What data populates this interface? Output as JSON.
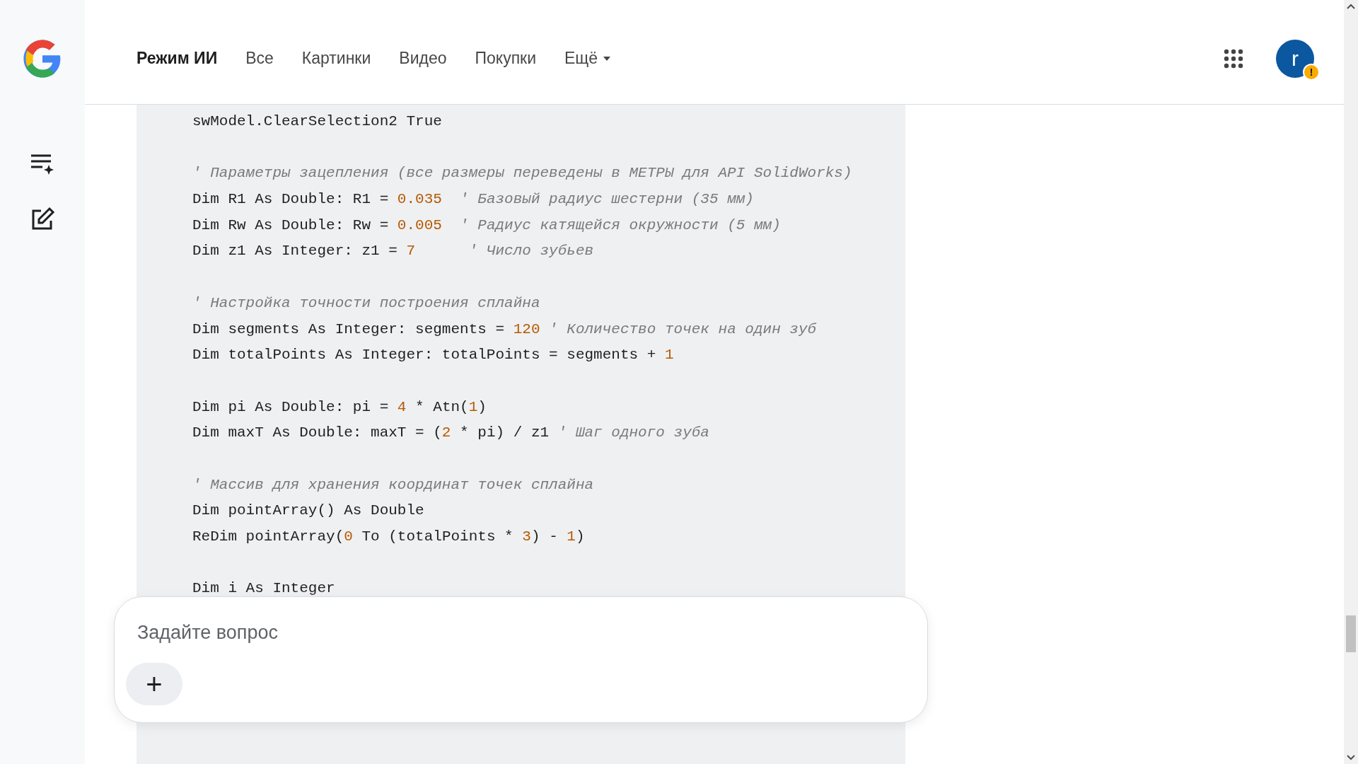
{
  "header": {
    "tabs": [
      {
        "label": "Режим ИИ",
        "selected": true
      },
      {
        "label": "Все",
        "selected": false
      },
      {
        "label": "Картинки",
        "selected": false
      },
      {
        "label": "Видео",
        "selected": false
      },
      {
        "label": "Покупки",
        "selected": false
      },
      {
        "label": "Ещё",
        "selected": false,
        "kind": "dropdown"
      }
    ],
    "avatar": {
      "letter": "r",
      "badge": "!"
    }
  },
  "code": {
    "lines": [
      {
        "kind": "code",
        "tokens": [
          {
            "kind": "text",
            "t": "swModel.ClearSelection2 True"
          }
        ]
      },
      {
        "kind": "blank"
      },
      {
        "kind": "code",
        "tokens": [
          {
            "kind": "comment",
            "t": "' Параметры зацепления (все размеры переведены в МЕТРЫ для API SolidWorks)"
          }
        ]
      },
      {
        "kind": "code",
        "tokens": [
          {
            "kind": "text",
            "t": "Dim R1 As Double: R1 = "
          },
          {
            "kind": "number",
            "t": "0.035"
          },
          {
            "kind": "comment",
            "t": "  ' Базовый радиус шестерни (35 мм)"
          }
        ]
      },
      {
        "kind": "code",
        "tokens": [
          {
            "kind": "text",
            "t": "Dim Rw As Double: Rw = "
          },
          {
            "kind": "number",
            "t": "0.005"
          },
          {
            "kind": "comment",
            "t": "  ' Радиус катящейся окружности (5 мм)"
          }
        ]
      },
      {
        "kind": "code",
        "tokens": [
          {
            "kind": "text",
            "t": "Dim z1 As Integer: z1 = "
          },
          {
            "kind": "number",
            "t": "7"
          },
          {
            "kind": "comment",
            "t": "      ' Число зубьев"
          }
        ]
      },
      {
        "kind": "blank"
      },
      {
        "kind": "code",
        "tokens": [
          {
            "kind": "comment",
            "t": "' Настройка точности построения сплайна"
          }
        ]
      },
      {
        "kind": "code",
        "tokens": [
          {
            "kind": "text",
            "t": "Dim segments As Integer: segments = "
          },
          {
            "kind": "number",
            "t": "120"
          },
          {
            "kind": "comment",
            "t": " ' Количество точек на один зуб"
          }
        ]
      },
      {
        "kind": "code",
        "tokens": [
          {
            "kind": "text",
            "t": "Dim totalPoints As Integer: totalPoints = segments + "
          },
          {
            "kind": "number",
            "t": "1"
          }
        ]
      },
      {
        "kind": "blank"
      },
      {
        "kind": "code",
        "tokens": [
          {
            "kind": "text",
            "t": "Dim pi As Double: pi = "
          },
          {
            "kind": "number",
            "t": "4"
          },
          {
            "kind": "text",
            "t": " * Atn("
          },
          {
            "kind": "number",
            "t": "1"
          },
          {
            "kind": "text",
            "t": ")"
          }
        ]
      },
      {
        "kind": "code",
        "tokens": [
          {
            "kind": "text",
            "t": "Dim maxT As Double: maxT = ("
          },
          {
            "kind": "number",
            "t": "2"
          },
          {
            "kind": "text",
            "t": " * pi) / z1 "
          },
          {
            "kind": "comment",
            "t": "' Шаг одного зуба"
          }
        ]
      },
      {
        "kind": "blank"
      },
      {
        "kind": "code",
        "tokens": [
          {
            "kind": "comment",
            "t": "' Массив для хранения координат точек сплайна"
          }
        ]
      },
      {
        "kind": "code",
        "tokens": [
          {
            "kind": "text",
            "t": "Dim pointArray() As Double"
          }
        ]
      },
      {
        "kind": "code",
        "tokens": [
          {
            "kind": "text",
            "t": "ReDim pointArray("
          },
          {
            "kind": "number",
            "t": "0"
          },
          {
            "kind": "text",
            "t": " To (totalPoints * "
          },
          {
            "kind": "number",
            "t": "3"
          },
          {
            "kind": "text",
            "t": ") - "
          },
          {
            "kind": "number",
            "t": "1"
          },
          {
            "kind": "text",
            "t": ")"
          }
        ]
      },
      {
        "kind": "blank"
      },
      {
        "kind": "code",
        "tokens": [
          {
            "kind": "text",
            "t": "Dim i As Integer"
          }
        ]
      }
    ]
  },
  "composer": {
    "placeholder": "Задайте вопрос",
    "add_button": "+"
  }
}
